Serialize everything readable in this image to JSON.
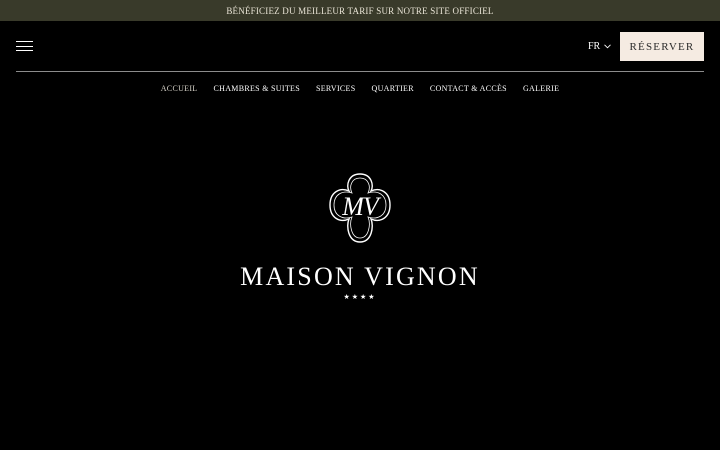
{
  "promo": {
    "text": "BÉNÉFICIEZ DU MEILLEUR TARIF SUR NOTRE SITE OFFICIEL"
  },
  "header": {
    "menu_icon": "hamburger-menu-icon",
    "language": "FR",
    "language_icon": "chevron-down-icon",
    "reserve_label": "RÉSERVER"
  },
  "nav": {
    "items": [
      {
        "label": "ACCUEIL"
      },
      {
        "label": "CHAMBRES & SUITES"
      },
      {
        "label": "SERVICES"
      },
      {
        "label": "QUARTIER"
      },
      {
        "label": "CONTACT & ACCÈS"
      },
      {
        "label": "GALERIE"
      }
    ],
    "active_index": 0
  },
  "logo": {
    "monogram": "MV",
    "name": "MAISON VIGNON",
    "stars": "★★★★"
  },
  "colors": {
    "promo_bg": "#393a2a",
    "page_bg": "#000000",
    "button_bg": "#f5ebe2",
    "button_text": "#2b2b2b"
  }
}
